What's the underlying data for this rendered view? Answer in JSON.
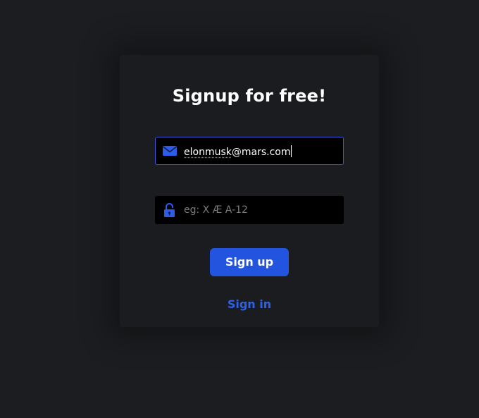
{
  "form": {
    "title": "Signup for free!",
    "email": {
      "value_prefix": "elonmusk",
      "value_suffix": "@mars.com",
      "icon": "envelope-icon"
    },
    "password": {
      "placeholder": "eg: X Æ A-12",
      "icon": "padlock-icon"
    },
    "signup_label": "Sign up",
    "signin_label": "Sign in"
  },
  "colors": {
    "background": "#1b1d20",
    "card": "#1a1c1f",
    "accent": "#2354e0",
    "link": "#2f62e6",
    "input_bg": "#000000",
    "focus_border": "#3b56d8"
  }
}
